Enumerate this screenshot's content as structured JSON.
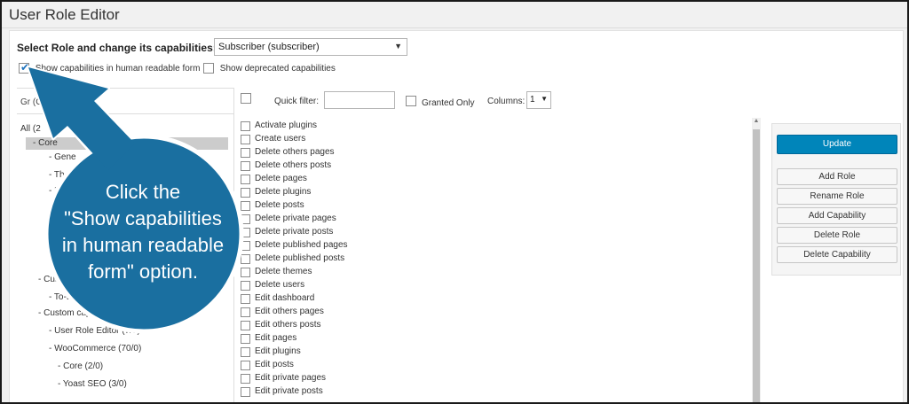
{
  "window": {
    "title": "User Role Editor"
  },
  "role": {
    "label": "Select Role and change its capabilities:",
    "selected": "Subscriber (subscriber)"
  },
  "options": {
    "human_readable": "Show capabilities in human readable form",
    "deprecated": "Show deprecated capabilities"
  },
  "groups": {
    "header": "Gr                (Granted)",
    "items": [
      "All (2",
      "- Core",
      "- Gene",
      "- The",
      "- P",
      "- Cust",
      "- To-D",
      "- Custom cap",
      "- User Role Editor (7/0)",
      "- WooCommerce (70/0)",
      "- Core (2/0)",
      "- Yoast SEO (3/0)"
    ]
  },
  "filter": {
    "quick_filter": "Quick filter:",
    "granted_only": "Granted Only",
    "columns_label": "Columns:",
    "columns_value": "1"
  },
  "capabilities": [
    "Activate plugins",
    "Create users",
    "Delete others pages",
    "Delete others posts",
    "Delete pages",
    "Delete plugins",
    "Delete posts",
    "Delete private pages",
    "Delete private posts",
    "Delete published pages",
    "Delete published posts",
    "Delete themes",
    "Delete users",
    "Edit dashboard",
    "Edit others pages",
    "Edit others posts",
    "Edit pages",
    "Edit plugins",
    "Edit posts",
    "Edit private pages",
    "Edit private posts"
  ],
  "actions": {
    "update": "Update",
    "add_role": "Add Role",
    "rename_role": "Rename Role",
    "add_capability": "Add Capability",
    "delete_role": "Delete Role",
    "delete_capability": "Delete Capability"
  },
  "callout": {
    "line1": "Click the",
    "line2": "\"Show capabilities",
    "line3": "in human readable",
    "line4": "form\" option."
  },
  "colors": {
    "primary_button": "#0085ba",
    "callout_fill": "#1a6fa0",
    "selected_group": "#cccccc"
  }
}
